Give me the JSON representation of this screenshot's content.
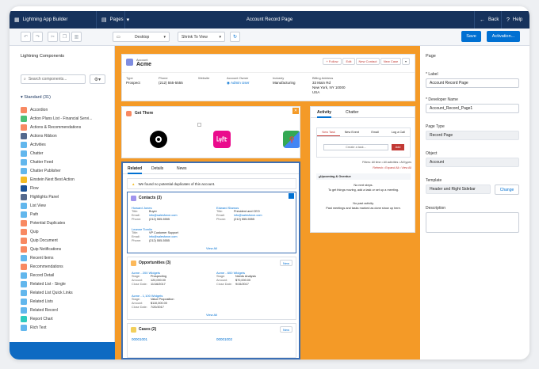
{
  "app": {
    "name": "Lightning App Builder",
    "pages": "Pages",
    "title": "Account Record Page",
    "back": "Back",
    "help": "Help"
  },
  "toolbar": {
    "device": "Desktop",
    "view": "Shrink To View",
    "save": "Save",
    "activation": "Activation..."
  },
  "left": {
    "title": "Lightning Components",
    "search_placeholder": "Search components...",
    "standard": "Standard (31)",
    "components": [
      {
        "label": "Accordion",
        "color": "#f88962"
      },
      {
        "label": "Action Plans List - Financial Servi...",
        "color": "#4bc076"
      },
      {
        "label": "Actions & Recommendations",
        "color": "#f88962"
      },
      {
        "label": "Actions Ribbon",
        "color": "#54698d"
      },
      {
        "label": "Activities",
        "color": "#62b7ed"
      },
      {
        "label": "Chatter",
        "color": "#62b7ed"
      },
      {
        "label": "Chatter Feed",
        "color": "#62b7ed"
      },
      {
        "label": "Chatter Publisher",
        "color": "#62b7ed"
      },
      {
        "label": "Einstein Next Best Action",
        "color": "#f4bc25"
      },
      {
        "label": "Flow",
        "color": "#1b5297"
      },
      {
        "label": "Highlights Panel",
        "color": "#54698d"
      },
      {
        "label": "List View",
        "color": "#62b7ed"
      },
      {
        "label": "Path",
        "color": "#62b7ed"
      },
      {
        "label": "Potential Duplicates",
        "color": "#f88962"
      },
      {
        "label": "Quip",
        "color": "#f88962"
      },
      {
        "label": "Quip Document",
        "color": "#f88962"
      },
      {
        "label": "Quip Notifications",
        "color": "#f88962"
      },
      {
        "label": "Recent Items",
        "color": "#62b7ed"
      },
      {
        "label": "Recommendations",
        "color": "#f88962"
      },
      {
        "label": "Record Detail",
        "color": "#62b7ed"
      },
      {
        "label": "Related List - Single",
        "color": "#62b7ed"
      },
      {
        "label": "Related List Quick Links",
        "color": "#62b7ed"
      },
      {
        "label": "Related Lists",
        "color": "#62b7ed"
      },
      {
        "label": "Related Record",
        "color": "#62b7ed"
      },
      {
        "label": "Report Chart",
        "color": "#2ecbbe"
      },
      {
        "label": "Rich Text",
        "color": "#62b7ed"
      }
    ]
  },
  "record": {
    "object": "Account",
    "name": "Acme",
    "follow": "+ Follow",
    "edit": "Edit",
    "new_contact": "New Contact",
    "new_case": "New Case",
    "f_type": "Type",
    "v_type": "Prospect",
    "f_phone": "Phone",
    "v_phone": "(212) 555-5555",
    "f_web": "Website",
    "f_owner": "Account Owner",
    "v_owner": "Admin User",
    "f_ind": "Industry",
    "v_ind": "Manufacturing",
    "f_addr": "Billing Address",
    "v_addr1": "33 Main Rd",
    "v_addr2": "New York, NY 10000",
    "v_addr3": "USA"
  },
  "getthere": {
    "title": "Get There"
  },
  "related": {
    "tab1": "Related",
    "tab2": "Details",
    "tab3": "News",
    "dup": "We found no potential duplicates of this account.",
    "contacts": {
      "title": "Contacts (3)",
      "view_all": "View All",
      "items": [
        {
          "name": "Howard Jones",
          "title": "Buyer",
          "email": "info@salesforce.com",
          "phone": "(212) 555-5555"
        },
        {
          "name": "Leanne Tomlin",
          "title": "VP Customer Support",
          "email": "info@salesforce.com",
          "phone": "(212) 555-5555"
        },
        {
          "name": "Edward Stamos",
          "title": "President and CEO",
          "email": "info@salesforce.com",
          "phone": "(212) 555-5555"
        }
      ]
    },
    "opps": {
      "title": "Opportunities (3)",
      "new": "New",
      "view_all": "View All",
      "items": [
        {
          "name": "Acme - 200 Widgets",
          "stage": "Prospecting",
          "amount": "120,000.00",
          "close": "11/16/2017"
        },
        {
          "name": "Acme - 1,100 Widgets",
          "stage": "Value Proposition",
          "amount": "$110,000.00",
          "close": "7/20/2017"
        },
        {
          "name": "Acme - 600 Widgets",
          "stage": "Needs Analysis",
          "amount": "$70,000.00",
          "close": "9/15/2017"
        }
      ]
    },
    "cases": {
      "title": "Cases (2)",
      "new": "New",
      "c1": "00001001",
      "c2": "00001002"
    },
    "lbl_title": "Title:",
    "lbl_email": "Email:",
    "lbl_phone": "Phone:",
    "lbl_stage": "Stage:",
    "lbl_amount": "Amount:",
    "lbl_close": "Close Date:"
  },
  "activity": {
    "tab1": "Activity",
    "tab2": "Chatter",
    "sub1": "New Task",
    "sub2": "New Event",
    "sub3": "Email",
    "sub4": "Log a Call",
    "task_ph": "Create a task...",
    "add": "Add",
    "filters": "Filters: All time • All activities • All types",
    "refresh": "Refresh • Expand All • View All",
    "upcoming": "Upcoming & Overdue",
    "no_steps": "No next steps.",
    "no_steps2": "To get things moving, add a task or set up a meeting.",
    "no_past": "No past activity.",
    "no_past2": "Past meetings and tasks marked as done show up here."
  },
  "props": {
    "title": "Page",
    "label": "* Label",
    "label_val": "Account Record Page",
    "dev": "* Developer Name",
    "dev_val": "Account_Record_Page1",
    "ptype": "Page Type",
    "ptype_val": "Record Page",
    "obj": "Object",
    "obj_val": "Account",
    "tmpl": "Template",
    "tmpl_val": "Header and Right Sidebar",
    "change": "Change",
    "desc": "Description"
  }
}
